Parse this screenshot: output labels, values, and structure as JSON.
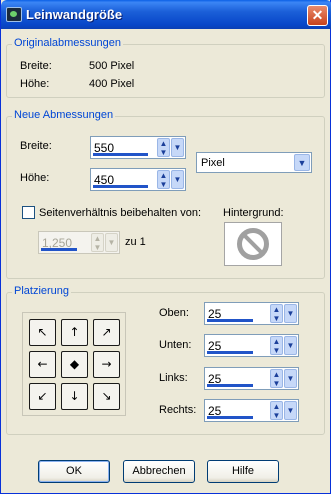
{
  "window": {
    "title": "Leinwandgröße",
    "close_label": "✕"
  },
  "original": {
    "group_label": "Originalabmessungen",
    "width_label": "Breite:",
    "width_value": "500 Pixel",
    "height_label": "Höhe:",
    "height_value": "400 Pixel"
  },
  "new_size": {
    "group_label": "Neue Abmessungen",
    "width_label": "Breite:",
    "width_value": "550",
    "height_label": "Höhe:",
    "height_value": "450",
    "unit_value": "Pixel",
    "aspect_label": "Seitenverhältnis beibehalten von:",
    "ratio_value": "1,250",
    "ratio_suffix": "zu 1",
    "background_label": "Hintergrund:"
  },
  "placement": {
    "group_label": "Platzierung",
    "grid_symbols": [
      "↖",
      "↑",
      "↗",
      "←",
      "◆",
      "→",
      "↙",
      "↓",
      "↘"
    ],
    "top_label": "Oben:",
    "top_value": "25",
    "bottom_label": "Unten:",
    "bottom_value": "25",
    "left_label": "Links:",
    "left_value": "25",
    "right_label": "Rechts:",
    "right_value": "25"
  },
  "buttons": {
    "ok": "OK",
    "cancel": "Abbrechen",
    "help": "Hilfe"
  },
  "colors": {
    "titlebar": "#0847c9",
    "group_title": "#0046d5",
    "value_bar": "#2154c8"
  }
}
